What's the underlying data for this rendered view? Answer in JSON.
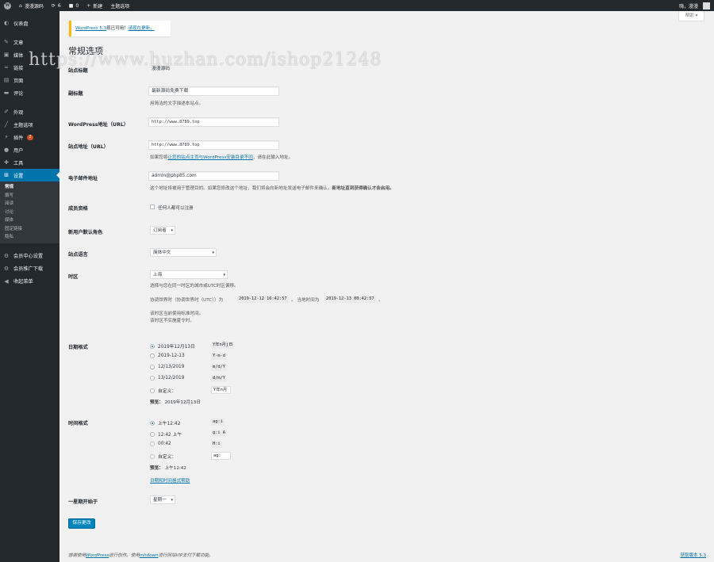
{
  "admin_bar": {
    "site_name": "漫漫源码",
    "updates_count": "6",
    "comments_count": "0",
    "new_label": "新建",
    "theme_options_label": "主题选项",
    "greeting": "嗨，漫漫"
  },
  "sidebar": {
    "items": [
      {
        "label": "仪表盘",
        "icon": "dashboard-icon"
      },
      {
        "label": "文章",
        "icon": "pin-icon"
      },
      {
        "label": "媒体",
        "icon": "media-icon"
      },
      {
        "label": "链接",
        "icon": "link-icon"
      },
      {
        "label": "页面",
        "icon": "page-icon"
      },
      {
        "label": "评论",
        "icon": "comment-icon"
      },
      {
        "label": "外观",
        "icon": "brush-icon"
      },
      {
        "label": "主题选项",
        "icon": "wrench-icon"
      },
      {
        "label": "插件",
        "icon": "plugin-icon",
        "badge": "2"
      },
      {
        "label": "用户",
        "icon": "user-icon"
      },
      {
        "label": "工具",
        "icon": "tools-icon"
      },
      {
        "label": "设置",
        "icon": "settings-icon"
      }
    ],
    "submenu": [
      "常规",
      "撰写",
      "阅读",
      "讨论",
      "媒体",
      "固定链接",
      "隐私"
    ],
    "extra": [
      {
        "label": "会员中心设置",
        "icon": "gear-icon"
      },
      {
        "label": "会员推广下载",
        "icon": "gear-icon"
      },
      {
        "label": "收起菜单",
        "icon": "collapse-icon"
      }
    ]
  },
  "help_label": "帮助 ▾",
  "notice": {
    "link": "WordPress 5.3",
    "text": "现已可用！",
    "action": "请现在更新。"
  },
  "page_title": "常规选项",
  "watermark": "https://www.huzhan.com/ishop21248",
  "fields": {
    "site_title": {
      "label": "站点标题",
      "value": "漫漫源码"
    },
    "tagline": {
      "label": "副标题",
      "value": "最新源码免费下载",
      "desc": "用简洁的文字描述本站点。"
    },
    "wp_url": {
      "label": "WordPress地址（URL）",
      "value": "http://www.8789.top"
    },
    "site_url": {
      "label": "站点地址（URL）",
      "value": "http://www.8789.top",
      "desc_pre": "如果您将",
      "desc_link": "让您的站点主页与WordPress安装目录不同",
      "desc_post": "，请在此输入地址。"
    },
    "admin_email": {
      "label": "电子邮件地址",
      "value": "admin@php85.com",
      "desc": "这个地址将被用于管理目的。如果您修改这个地址，我们将会向新地址发送电子邮件来确认。",
      "desc_bold": "新地址直到获得确认才会启用。"
    },
    "membership": {
      "label": "成员资格",
      "checkbox_label": "任何人都可以注册"
    },
    "default_role": {
      "label": "新用户默认角色",
      "value": "订阅者"
    },
    "site_language": {
      "label": "站点语言",
      "value": "简体中文"
    },
    "timezone": {
      "label": "时区",
      "value": "上海",
      "desc": "选择与您在同一时区的城市或UTC时区偏移。",
      "utc_pre": "协调世界时（协调世界时（UTC））为",
      "utc_time": "2019-12-12 16:42:57",
      "local_pre": "。 当地时间为",
      "local_time": "2019-12-13 00:42:57",
      "local_post": "。",
      "dst1": "该时区当前使用标准时间。",
      "dst2": "该时区不实施夏令时。"
    },
    "date_format": {
      "label": "日期格式",
      "options": [
        {
          "label": "2019年12月13日",
          "code": "Y年n月j日",
          "checked": true
        },
        {
          "label": "2019-12-13",
          "code": "Y-m-d",
          "checked": false
        },
        {
          "label": "12/13/2019",
          "code": "m/d/Y",
          "checked": false
        },
        {
          "label": "13/12/2019",
          "code": "d/m/Y",
          "checked": false
        }
      ],
      "custom_label": "自定义：",
      "custom_value": "Y年n月",
      "preview_label": "预览：",
      "preview_value": "2019年12月13日"
    },
    "time_format": {
      "label": "时间格式",
      "options": [
        {
          "label": "上午12:42",
          "code": "ag:i",
          "checked": true
        },
        {
          "label": "12:42 上午",
          "code": "g:i A",
          "checked": false
        },
        {
          "label": "00:42",
          "code": "H:i",
          "checked": false
        }
      ],
      "custom_label": "自定义：",
      "custom_value": "ag:",
      "preview_label": "预览：",
      "preview_value": "上午12:42",
      "doc_link": "日期和时间格式帮助"
    },
    "week_start": {
      "label": "一星期开始于",
      "value": "星期一"
    }
  },
  "save_button": "保存更改",
  "footer": {
    "pre": "感谢使用",
    "wp": "WordPress",
    "mid": "进行创作。使用",
    "link": "mhdown",
    "post": "进行网站VIP支付下载功能。"
  },
  "version_link": "获取版本 5.3"
}
